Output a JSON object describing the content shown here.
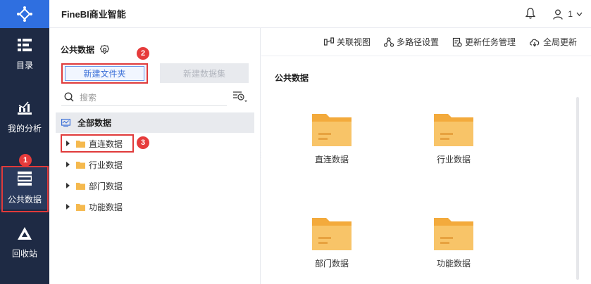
{
  "app": {
    "title": "FineBI商业智能"
  },
  "header": {
    "user_label": "1"
  },
  "rail": {
    "items": [
      {
        "label": "目录",
        "icon": "catalog-icon"
      },
      {
        "label": "我的分析",
        "icon": "analysis-icon"
      },
      {
        "label": "公共数据",
        "icon": "public-data-icon",
        "active": true
      },
      {
        "label": "回收站",
        "icon": "recycle-icon"
      }
    ]
  },
  "badges": {
    "b1": "1",
    "b2": "2",
    "b3": "3"
  },
  "panel": {
    "title": "公共数据",
    "new_folder": "新建文件夹",
    "new_dataset": "新建数据集",
    "search_placeholder": "搜索",
    "tree_root": "全部数据",
    "tree_items": [
      "直连数据",
      "行业数据",
      "部门数据",
      "功能数据"
    ]
  },
  "toolbar": {
    "items": [
      "关联视图",
      "多路径设置",
      "更新任务管理",
      "全局更新"
    ]
  },
  "content": {
    "title": "公共数据",
    "folders": [
      "直连数据",
      "行业数据",
      "部门数据",
      "功能数据"
    ]
  },
  "colors": {
    "rail_bg": "#1e2a44",
    "brand": "#2f6fe0",
    "folder": "#f5b94e",
    "highlight": "#e03a3a"
  }
}
